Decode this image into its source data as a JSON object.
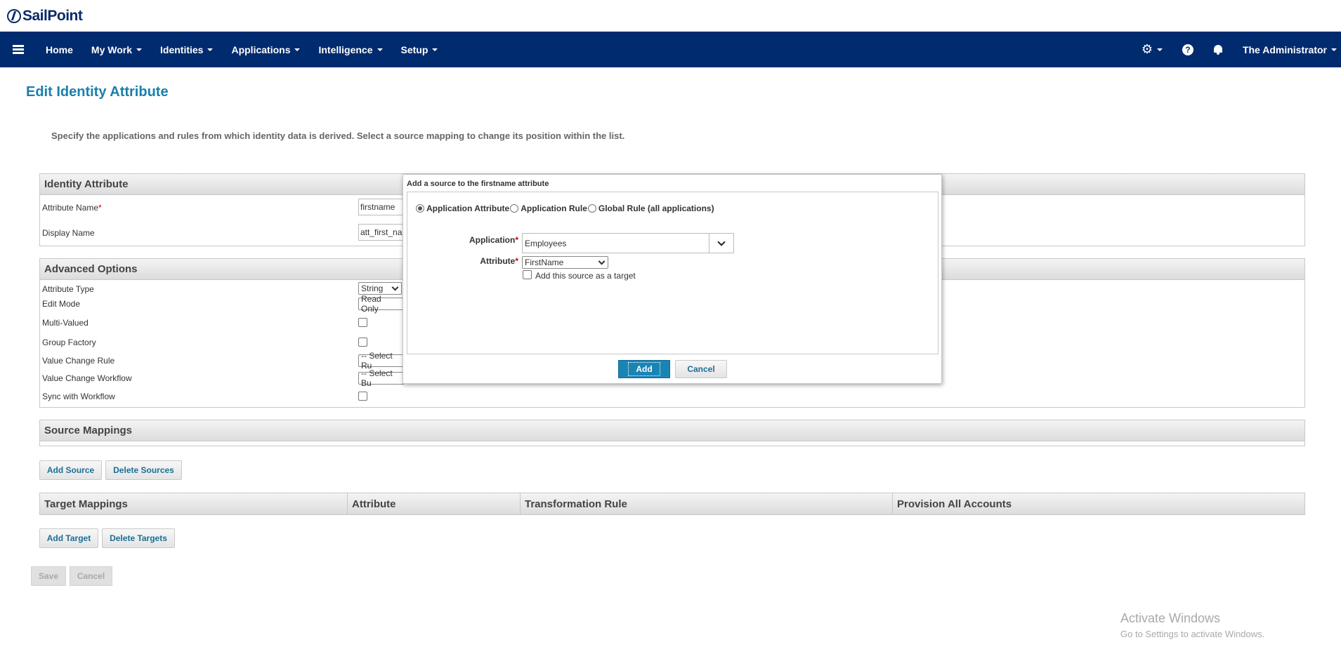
{
  "brand": {
    "logo_text": "SailPoint"
  },
  "navbar": {
    "home": "Home",
    "my_work": "My Work",
    "identities": "Identities",
    "applications": "Applications",
    "intelligence": "Intelligence",
    "setup": "Setup",
    "user": "The Administrator",
    "colors": {
      "bar": "#002b6f"
    }
  },
  "page": {
    "title": "Edit Identity Attribute",
    "instructions": "Specify the applications and rules from which identity data is derived. Select a source mapping to change its position within the list."
  },
  "identity_attribute": {
    "header": "Identity Attribute",
    "attribute_name_label": "Attribute Name",
    "attribute_name_value": "firstname",
    "display_name_label": "Display Name",
    "display_name_value": "att_first_nar"
  },
  "advanced_options": {
    "header": "Advanced Options",
    "attribute_type_label": "Attribute Type",
    "attribute_type_value": "String",
    "edit_mode_label": "Edit Mode",
    "edit_mode_value": "Read Only",
    "multi_valued_label": "Multi-Valued",
    "group_factory_label": "Group Factory",
    "value_change_rule_label": "Value Change Rule",
    "value_change_rule_value": "-- Select Ru",
    "value_change_workflow_label": "Value Change Workflow",
    "value_change_workflow_value": "-- Select Bu",
    "sync_with_workflow_label": "Sync with Workflow"
  },
  "source_mappings": {
    "header": "Source Mappings",
    "add_source": "Add Source",
    "delete_sources": "Delete Sources"
  },
  "target_mappings": {
    "columns": [
      "Target Mappings",
      "Attribute",
      "Transformation Rule",
      "Provision All Accounts"
    ],
    "add_target": "Add Target",
    "delete_targets": "Delete Targets"
  },
  "footer_buttons": {
    "save": "Save",
    "cancel": "Cancel"
  },
  "modal": {
    "title": "Add a source to the firstname attribute",
    "radio_app_attribute": "Application Attribute",
    "radio_app_rule": "Application Rule",
    "radio_global_rule": "Global Rule (all applications)",
    "application_label": "Application",
    "application_value": "Employees",
    "attribute_label": "Attribute",
    "attribute_value": "FirstName",
    "add_as_target_label": "Add this source as a target",
    "add_button": "Add",
    "cancel_button": "Cancel"
  },
  "watermark": {
    "line1": "Activate Windows",
    "line2": "Go to Settings to activate Windows."
  }
}
